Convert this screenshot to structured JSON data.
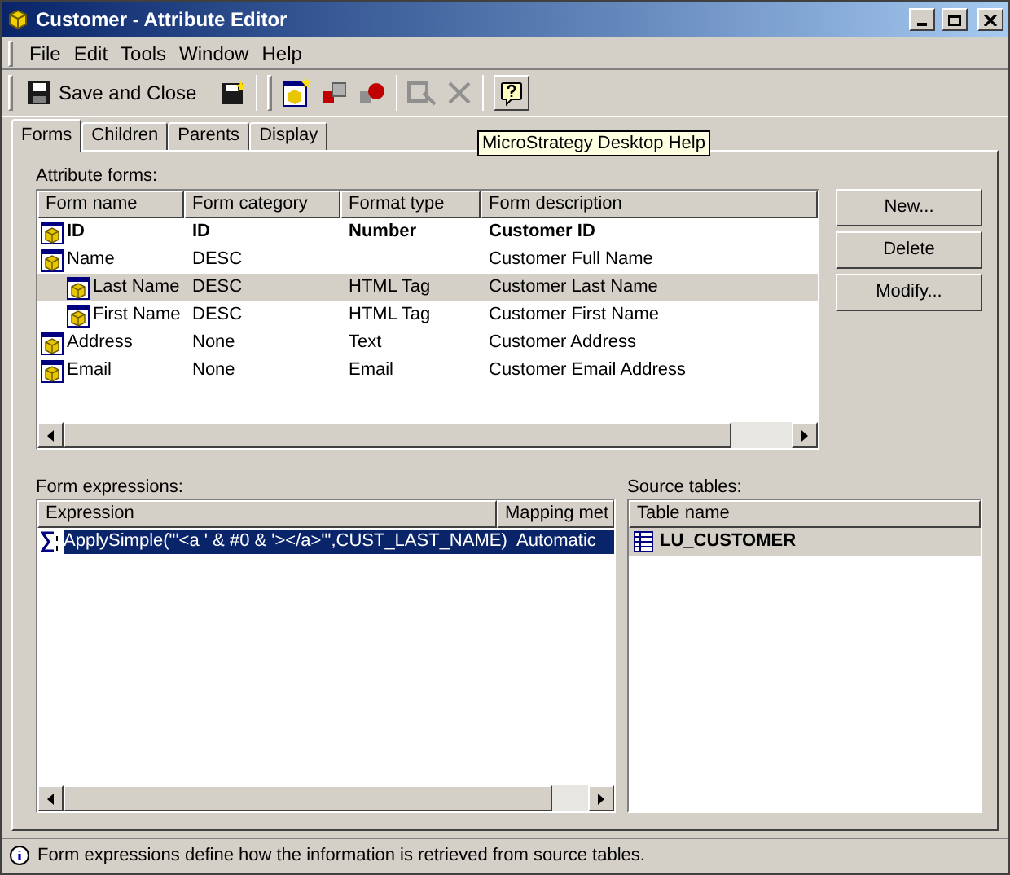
{
  "window": {
    "title": "Customer - Attribute Editor"
  },
  "menu": [
    "File",
    "Edit",
    "Tools",
    "Window",
    "Help"
  ],
  "toolbar": {
    "save_label": "Save and Close",
    "tooltip": "MicroStrategy Desktop Help"
  },
  "tabs": [
    {
      "label": "Forms",
      "selected": true
    },
    {
      "label": "Children",
      "selected": false
    },
    {
      "label": "Parents",
      "selected": false
    },
    {
      "label": "Display",
      "selected": false
    }
  ],
  "attribute_forms": {
    "label": "Attribute forms:",
    "columns": [
      "Form name",
      "Form category",
      "Format type",
      "Form description"
    ],
    "rows": [
      {
        "cells": [
          "ID",
          "ID",
          "Number",
          "Customer ID"
        ],
        "bold": true,
        "selected": false
      },
      {
        "cells": [
          "Name",
          "DESC",
          "",
          "Customer Full Name"
        ],
        "bold": false,
        "selected": false,
        "children": [
          {
            "cells": [
              "Last Name",
              "DESC",
              "HTML Tag",
              "Customer Last Name"
            ],
            "bold": false,
            "selected": true
          },
          {
            "cells": [
              "First Name",
              "DESC",
              "HTML Tag",
              "Customer First Name"
            ],
            "bold": false,
            "selected": false
          }
        ]
      },
      {
        "cells": [
          "Address",
          "None",
          "Text",
          "Customer Address"
        ],
        "bold": false,
        "selected": false
      },
      {
        "cells": [
          "Email",
          "None",
          "Email",
          "Customer Email Address"
        ],
        "bold": false,
        "selected": false
      }
    ]
  },
  "buttons": [
    "New...",
    "Delete",
    "Modify..."
  ],
  "form_expressions": {
    "label": "Form expressions:",
    "columns": [
      "Expression",
      "Mapping met"
    ],
    "rows": [
      {
        "cells": [
          "ApplySimple(\"'<a ' & #0 & '></a>'\",CUST_LAST_NAME)",
          "Automatic"
        ],
        "selected": true
      }
    ]
  },
  "source_tables": {
    "label": "Source tables:",
    "columns": [
      "Table name"
    ],
    "rows": [
      {
        "name": "LU_CUSTOMER",
        "selected": true
      }
    ]
  },
  "status_bar": "Form expressions define how the information is retrieved from source tables."
}
